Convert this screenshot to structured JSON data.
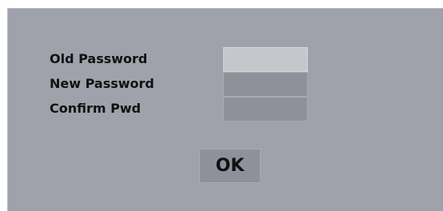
{
  "password_form": {
    "old_password_label": "Old Password",
    "new_password_label": "New Password",
    "confirm_password_label": "Confirm Pwd",
    "old_password_value": "",
    "new_password_value": "",
    "confirm_password_value": "",
    "focused_field": "old_password",
    "ok_label": "OK"
  },
  "colors": {
    "panel_background": "#9fa2aa",
    "focused_field_background": "#c4c7cc",
    "field_background": "#8e9199",
    "text": "#111111"
  }
}
